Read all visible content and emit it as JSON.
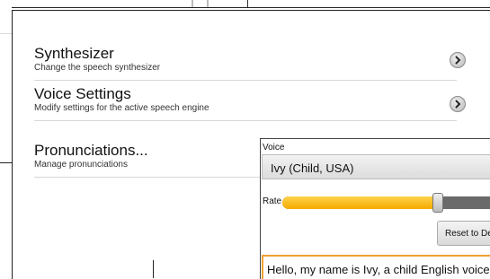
{
  "settings": {
    "items": [
      {
        "title": "Synthesizer",
        "subtitle": "Change the speech synthesizer",
        "icon": "chevron-right-icon"
      },
      {
        "title": "Voice Settings",
        "subtitle": "Modify settings for the active speech engine",
        "icon": "chevron-right-icon"
      },
      {
        "title": "Pronunciations...",
        "subtitle": "Manage pronunciations"
      }
    ]
  },
  "voice_dialog": {
    "voice_label": "Voice",
    "voice_value": "Ivy (Child, USA)",
    "rate_label": "Rate",
    "rate_level": 0.72,
    "reset_label": "Reset to Default",
    "sample_text": "Hello, my name is Ivy, a child English voice."
  },
  "colors": {
    "slider_fill": "#f3aa00",
    "text_focus_border": "#f0a030"
  }
}
